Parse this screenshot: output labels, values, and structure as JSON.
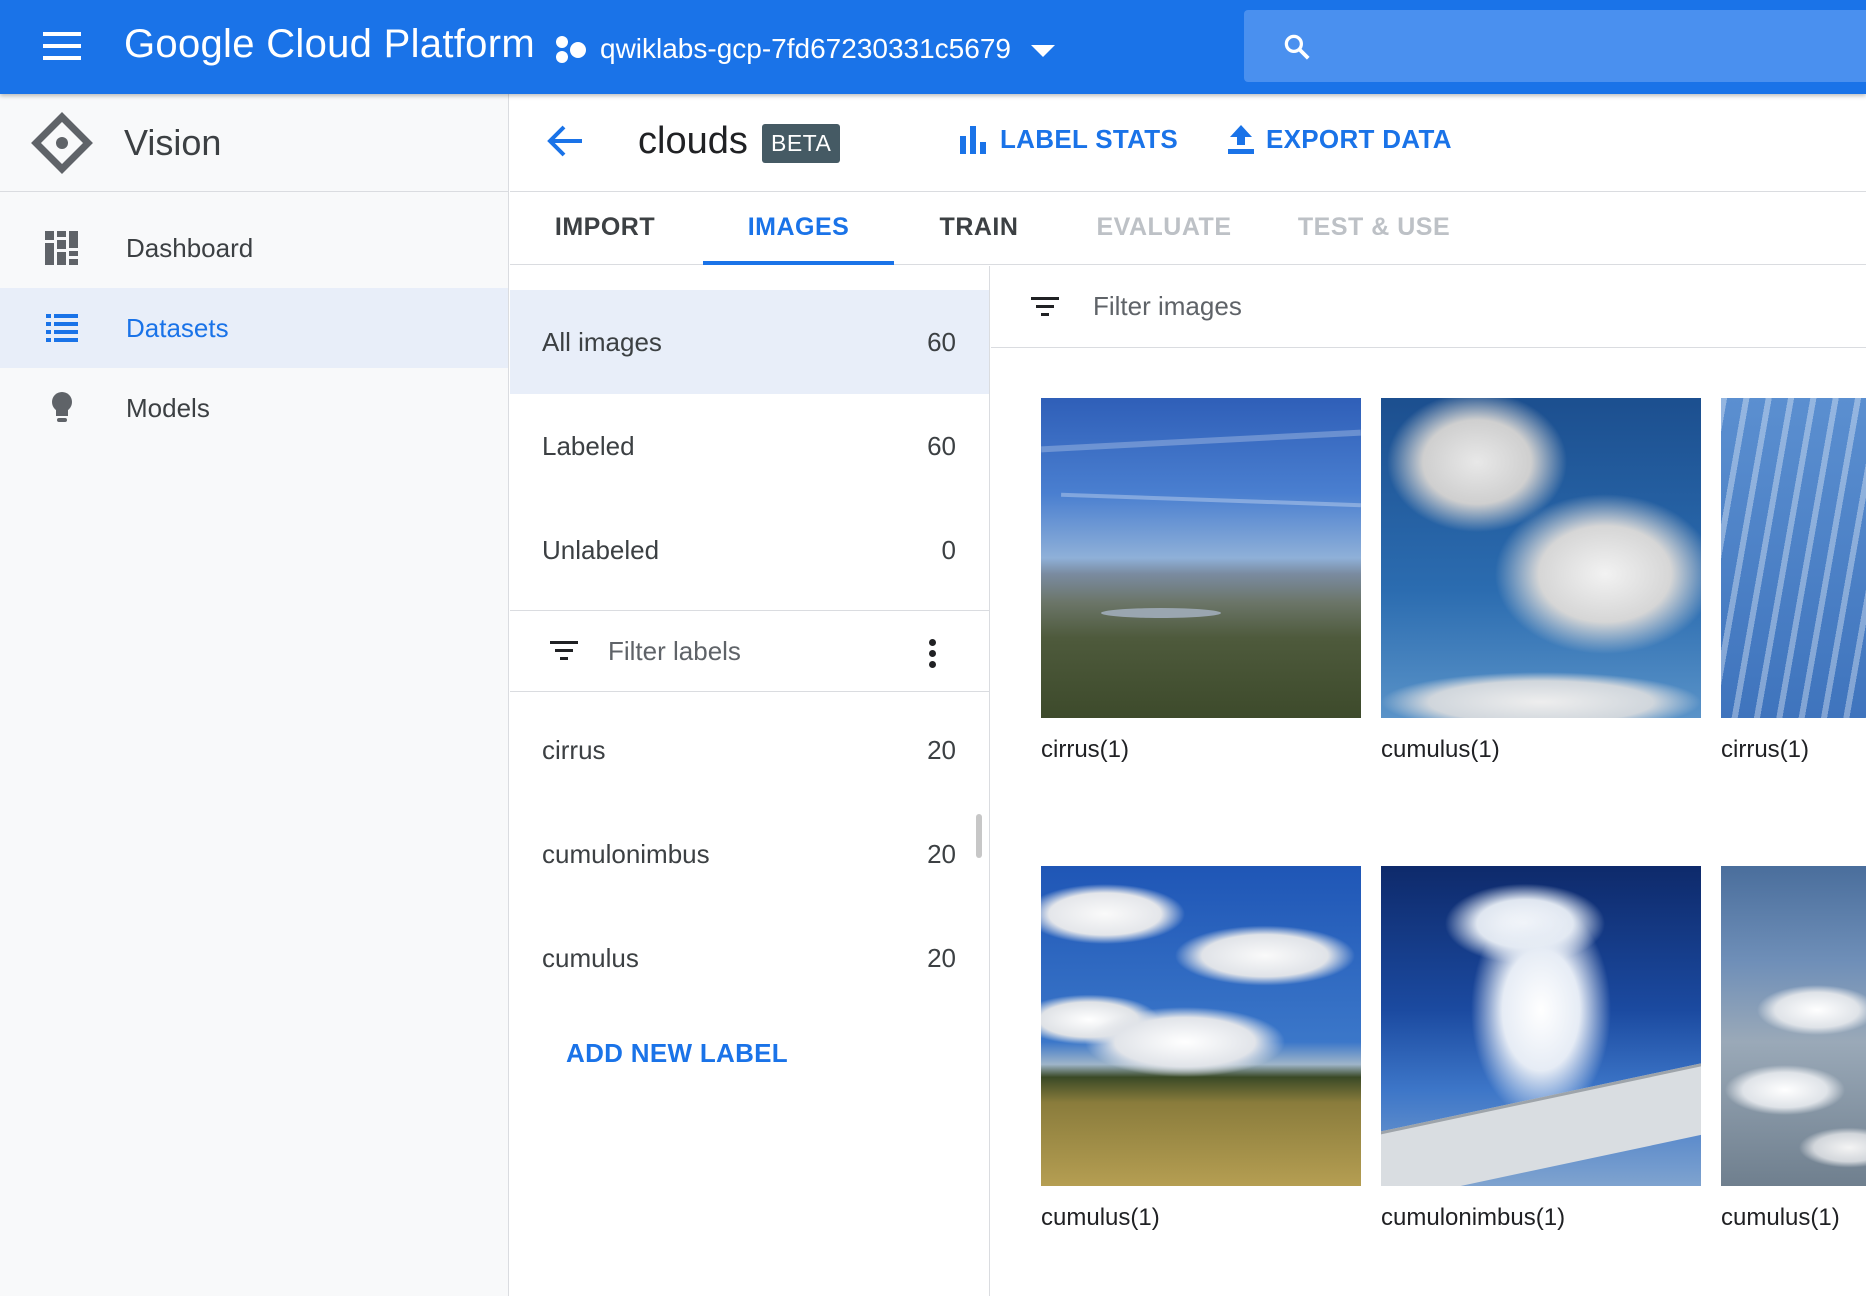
{
  "topbar": {
    "brand": "Google Cloud Platform",
    "project": "qwiklabs-gcp-7fd67230331c5679",
    "brand_color": "#1a73e8"
  },
  "product": {
    "name": "Vision"
  },
  "nav": [
    {
      "label": "Dashboard",
      "icon": "dashboard-icon"
    },
    {
      "label": "Datasets",
      "icon": "list-icon",
      "active": true
    },
    {
      "label": "Models",
      "icon": "lightbulb-icon"
    }
  ],
  "dataset": {
    "title": "clouds",
    "badge": "BETA",
    "label_stats": "LABEL STATS",
    "export_data": "EXPORT DATA"
  },
  "tabs": [
    {
      "label": "IMPORT",
      "state": "normal"
    },
    {
      "label": "IMAGES",
      "state": "active"
    },
    {
      "label": "TRAIN",
      "state": "normal"
    },
    {
      "label": "EVALUATE",
      "state": "disabled"
    },
    {
      "label": "TEST & USE",
      "state": "disabled"
    }
  ],
  "counts": [
    {
      "label": "All images",
      "count": "60"
    },
    {
      "label": "Labeled",
      "count": "60"
    },
    {
      "label": "Unlabeled",
      "count": "0"
    }
  ],
  "filter_labels_placeholder": "Filter labels",
  "labels": [
    {
      "label": "cirrus",
      "count": "20"
    },
    {
      "label": "cumulonimbus",
      "count": "20"
    },
    {
      "label": "cumulus",
      "count": "20"
    }
  ],
  "add_label": "ADD NEW LABEL",
  "filter_images_placeholder": "Filter images",
  "images": [
    {
      "caption": "cirrus(1)"
    },
    {
      "caption": "cumulus(1)"
    },
    {
      "caption": "cirrus(1)"
    },
    {
      "caption": "cumulus(1)"
    },
    {
      "caption": "cumulonimbus(1)"
    },
    {
      "caption": "cumulus(1)"
    }
  ]
}
